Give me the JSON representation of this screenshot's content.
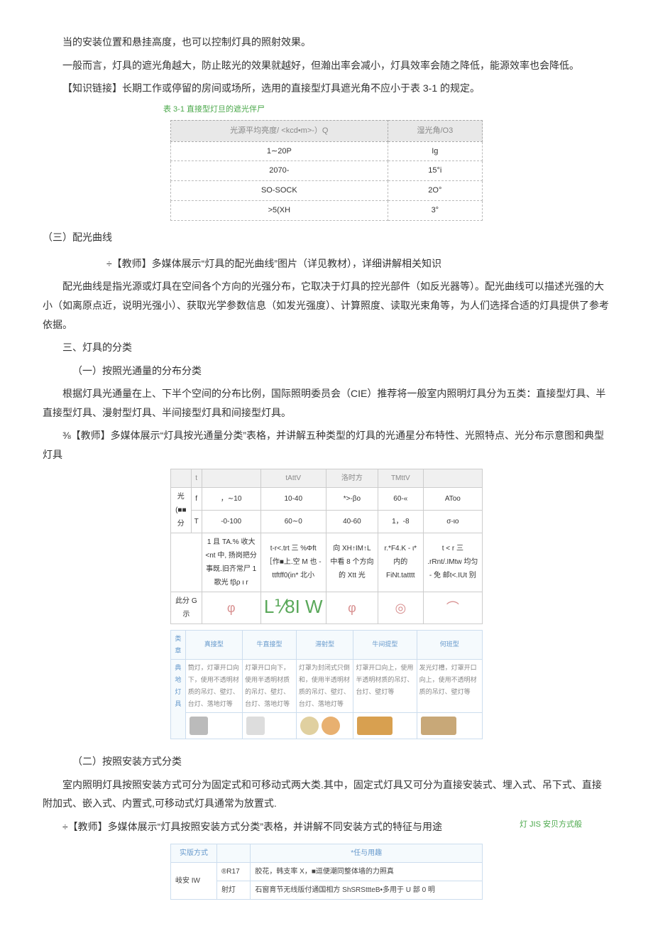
{
  "p1": "当的安装位置和悬挂高度，也可以控制灯具的照射效果。",
  "p2": "一般而言，灯具的遮光角越大，防止眩光的效果就越好，但瀚出率会减小，灯具效率会随之降低，能源效率也会降低。",
  "p3": "【知识链接】长期工作或停留的房间或场所，选用的直接型灯具遮光角不应小于表 3-1 的规定。",
  "t31_caption": "表 3-1 直接型灯旦的遮光伴尸",
  "t31_h1": "光源平均亮度/ <kcd•m>-）Q",
  "t31_h2": "湿光角/O3",
  "t31": [
    {
      "a": "1∼20P",
      "b": "Ig"
    },
    {
      "a": "2070-",
      "b": "15°i"
    },
    {
      "a": "SO-SOCK",
      "b": "2O°"
    },
    {
      "a": ">5(XH",
      "b": "3°"
    }
  ],
  "sec3": "（三）配光曲线",
  "p4": "÷【教师】多媒体展示“灯具的配光曲线”图片（详见教材），详细讲解相关知识",
  "p5": "配光曲线是指光源或灯具在空间各个方向的光强分布，它取决于灯具的控光部件（如反光器等）。配光曲线可以描述光强的大小（如离原点近，说明光强小）、获取光学参数信息（如发光强度）、计算照度、读取光束角等，为人们选择合适的灯具提供了参考依据。",
  "h3": "三、灯具的分类",
  "sub1": "（一）按照光通量的分布分类",
  "p6": "根据灯具光通量在上、下半个空间的分布比例，国际照明委员会（CIE）推荐将一般室内照明灯具分为五类：直接型灯具、半直接型灯具、漫射型灯具、半间接型灯具和间接型灯具。",
  "p7": "⅜【教师】多媒体展示“灯具按光通量分类”表格，并讲解五种类型的灯具的光通星分布特性、光照特点、光分布示意图和典型灯具",
  "flux": {
    "head": [
      "",
      "t",
      "",
      "tAttV",
      "洛时方",
      "TMttV",
      ""
    ],
    "row1": [
      "光(■■分",
      "f",
      "，∼10",
      "10-40",
      "*>-βo",
      "60-«",
      "AToo"
    ],
    "row2": [
      "",
      "T",
      "-0-100",
      "60∼0",
      "40-60",
      "1，-8",
      "σ-ιo"
    ],
    "row3_cells": [
      "1 且 TA.% 收大 <nt 中, 扬岗把分事既.旧齐常尸 1 歌光 fβρ ι r",
      "t-r<.trt 三 %Φft［作■上.空 M 也 - ttftff0(in* 北小",
      "向 XH↑IM↑L 中看 8 个方向的 Xtt 光",
      "r.*F4.K - ι*内的 FiNt.tatttt",
      "t < r 三 .rRnt/.IMtw 均匀 - 免 邮t<.IUt 别"
    ],
    "diag_label": "此分 G 示",
    "diag_center": "L⅟8I W"
  },
  "typical": {
    "headers": [
      "类章",
      "真接型",
      "牛直接型",
      "滞射型",
      "牛间提型",
      "何班型"
    ],
    "row_label": "典地灯具",
    "cells": [
      "筒灯，灯罩开口向下，使用不透明材质的吊灯、壁灯、台灯、落地灯等",
      "灯罩开口向下，使用半透明材质的吊灯、壁灯、台灯、落地灯等",
      "灯罩为封闭式只倒和，使用半透明材质的吊灯、壁灯、台灯、落地灯等",
      "灯罩开口向上，使用半透明材质的吊灯、台灯、壁灯等",
      "发光灯槽，灯罩开口向上，使用不透明材质的吊灯、壁灯等"
    ]
  },
  "sub2": "（二）按照安装方式分类",
  "p8": "室内照明灯具按照安装方式可分为固定式和可移动式两大类.其中，固定式灯具又可分为直接安装式、埋入式、吊下式、直接附加式、嵌入式、内置式,可移动式灯具通常为放置式.",
  "p9": "÷【教师】多媒体展示“灯具按照安装方式分类”表格，并讲解不同安装方式的特征与用途",
  "right_note": "灯 JIS 安贝方式般",
  "install": {
    "headers": [
      "实版方式",
      "",
      "*任与用趣"
    ],
    "rows": [
      {
        "a": "岐安 IW",
        "b": "®R17",
        "c": "胶花，韩支率 X，■逗便潮同整体墙的力照真"
      },
      {
        "a": "",
        "b": "射灯",
        "c": "石窗育节无线版付通国相方 ShSRSttteB•多用于 U 部 0 明"
      }
    ]
  }
}
